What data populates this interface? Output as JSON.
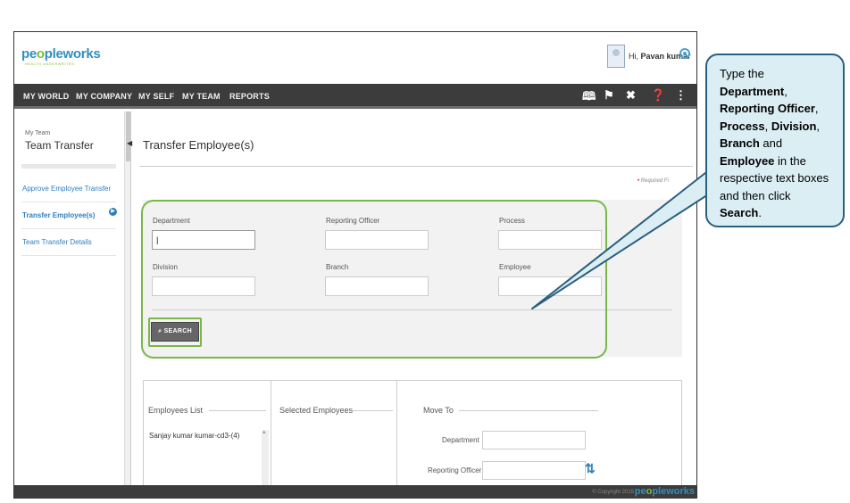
{
  "header": {
    "logo_text_a": "pe",
    "logo_text_o": "o",
    "logo_text_b": "pleworks",
    "logo_tagline": "HEALTH UNDERWRITES",
    "greeting_prefix": "Hi,",
    "user_name": "Pavan kumar"
  },
  "nav": {
    "items": [
      "MY WORLD",
      "MY COMPANY",
      "MY SELF",
      "MY TEAM",
      "REPORTS"
    ],
    "icons": [
      "book-icon",
      "flag-icon",
      "tools-icon",
      "help-icon",
      "share-icon"
    ]
  },
  "sidebar": {
    "breadcrumb": "My Team",
    "title": "Team Transfer",
    "items": [
      {
        "label": "Approve Employee Transfer"
      },
      {
        "label": "Transfer Employee(s)"
      },
      {
        "label": "Team Transfer Details"
      }
    ]
  },
  "main": {
    "title": "Transfer Employee(s)",
    "required_note": "Required Fi"
  },
  "form": {
    "department_label": "Department",
    "reporting_officer_label": "Reporting Officer",
    "process_label": "Process",
    "division_label": "Division",
    "branch_label": "Branch",
    "employee_label": "Employee",
    "search_label": "SEARCH",
    "department_value": "|"
  },
  "lists": {
    "employees_title": "Employees List",
    "selected_title": "Selected Employees",
    "move_to_title": "Move To",
    "employees": [
      "Sanjay kumar kumar-cd3-(4)"
    ],
    "move_department_label": "Department",
    "move_reporting_label": "Reporting Officer"
  },
  "footer": {
    "copyright": "© Copyright 2015",
    "logo_a": "pe",
    "logo_o": "o",
    "logo_b": "pleworks"
  },
  "callout": {
    "t1": "Type the",
    "b1": "Department",
    "t2": ",",
    "b2": "Reporting Officer",
    "t3": ",",
    "b3": "Process",
    "t4": ",",
    "b4": "Division",
    "t5": ",",
    "b5": "Branch",
    "t6": " and ",
    "b6": "Employee",
    "t7": " in the respective text boxes and then click ",
    "b7": "Search",
    "t8": "."
  },
  "colors": {
    "nav_bg": "#3c3c3c",
    "link_blue": "#2f7fbf",
    "highlight_green": "#7ab648",
    "callout_bg": "#dbeef4",
    "callout_border": "#2b5f7e"
  }
}
